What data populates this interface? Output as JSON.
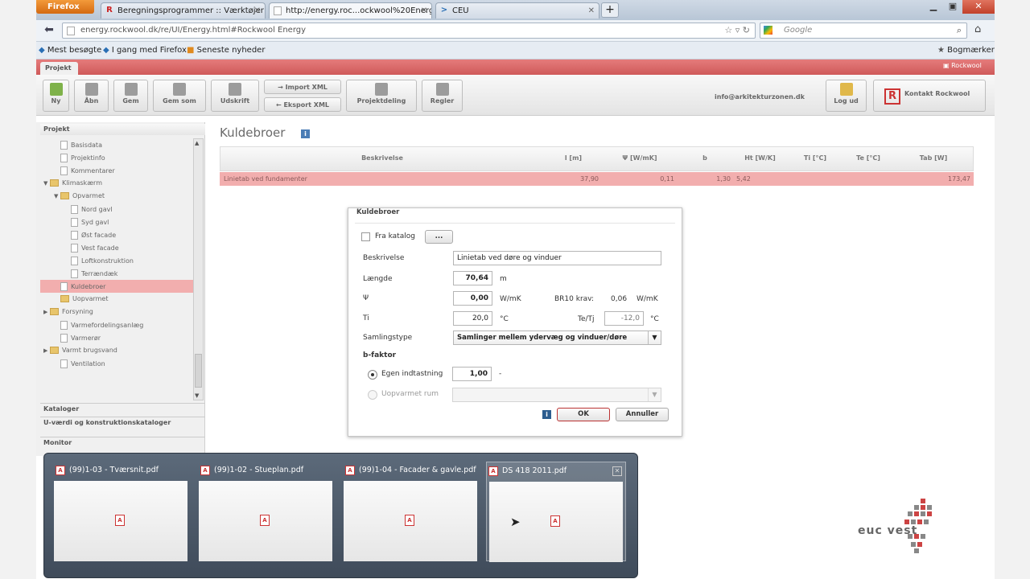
{
  "browser": {
    "firefox_button": "Firefox",
    "tabs": [
      {
        "label": "Beregningsprogrammer :: Værktøjer :...",
        "favicon": "R"
      },
      {
        "label": "http://energy.roc...ockwool%20Energy",
        "favicon": ""
      },
      {
        "label": "CEU",
        "favicon": ">"
      }
    ],
    "new_tab": "+",
    "url": "energy.rockwool.dk/re/UI/Energy.html#Rockwool Energy",
    "search_placeholder": "Google",
    "bookmarks": [
      "Mest besøgte",
      "I gang med Firefox",
      "Seneste nyheder"
    ],
    "bookmarks_menu": "Bogmærker"
  },
  "app": {
    "top_tab": "Projekt",
    "brand_top": "Rockwool",
    "toolbar": {
      "buttons": [
        "Ny",
        "Åbn",
        "Gem",
        "Gem som",
        "Udskrift"
      ],
      "import_xml": "Import XML",
      "export_xml": "Eksport XML",
      "project_share": "Projektdeling",
      "rules": "Regler",
      "email": "info@arkitekturzonen.dk",
      "logout": "Log ud",
      "contact": "Kontakt Rockwool"
    },
    "sidebar": {
      "header": "Projekt",
      "items": [
        {
          "label": "Basisdata",
          "type": "page",
          "indent": 1
        },
        {
          "label": "Projektinfo",
          "type": "page",
          "indent": 1
        },
        {
          "label": "Kommentarer",
          "type": "page",
          "indent": 1
        },
        {
          "label": "Klimaskærm",
          "type": "folder",
          "indent": 0
        },
        {
          "label": "Opvarmet",
          "type": "folder",
          "indent": 1
        },
        {
          "label": "Nord gavl",
          "type": "page",
          "indent": 2
        },
        {
          "label": "Syd gavl",
          "type": "page",
          "indent": 2
        },
        {
          "label": "Øst facade",
          "type": "page",
          "indent": 2
        },
        {
          "label": "Vest facade",
          "type": "page",
          "indent": 2
        },
        {
          "label": "Loftkonstruktion",
          "type": "page",
          "indent": 2
        },
        {
          "label": "Terrændæk",
          "type": "page",
          "indent": 2
        },
        {
          "label": "Kuldebroer",
          "type": "page",
          "indent": 1,
          "selected": true
        },
        {
          "label": "Uopvarmet",
          "type": "folder",
          "indent": 1
        },
        {
          "label": "Forsyning",
          "type": "folder",
          "indent": 0
        },
        {
          "label": "Varmefordelingsanlæg",
          "type": "page",
          "indent": 1
        },
        {
          "label": "Varmerør",
          "type": "page",
          "indent": 1
        },
        {
          "label": "Varmt brugsvand",
          "type": "folder",
          "indent": 0
        },
        {
          "label": "Ventilation",
          "type": "page",
          "indent": 1
        }
      ],
      "sections": [
        "Kataloger",
        "U-værdi og konstruktionskataloger",
        "Monitor"
      ]
    },
    "main": {
      "title": "Kuldebroer",
      "columns": [
        "Beskrivelse",
        "l [m]",
        "Ψ [W/mK]",
        "b",
        "Ht [W/K]",
        "Ti [°C]",
        "Te [°C]",
        "Tab [W]"
      ],
      "row": [
        "Linietab ved fundamenter",
        "37,90",
        "0,11",
        "1,30",
        "5,42",
        "",
        "",
        "173,47"
      ]
    }
  },
  "dialog": {
    "title": "Kuldebroer",
    "fra_katalog": "Fra katalog",
    "katalog_btn": "...",
    "beskrivelse_label": "Beskrivelse",
    "beskrivelse_value": "Linietab ved døre og vinduer",
    "laengde_label": "Længde",
    "laengde_value": "70,64",
    "laengde_unit": "m",
    "psi_label": "Ψ",
    "psi_value": "0,00",
    "psi_unit": "W/mK",
    "br10_label": "BR10 krav:",
    "br10_value": "0,06",
    "br10_unit": "W/mK",
    "ti_label": "Ti",
    "ti_value": "20,0",
    "ti_unit": "°C",
    "tetj_label": "Te/Tj",
    "tetj_value": "-12,0",
    "tetj_unit": "°C",
    "samling_label": "Samlingstype",
    "samling_value": "Samlinger mellem ydervæg og vinduer/døre",
    "bfaktor_label": "b-faktor",
    "egen_label": "Egen indtastning",
    "egen_value": "1,00",
    "egen_unit": "-",
    "uopvarmet_label": "Uopvarmet rum",
    "ok": "OK",
    "cancel": "Annuller"
  },
  "taskbar": {
    "previews": [
      "(99)1-03 - Tværsnit.pdf",
      "(99)1-02 - Stueplan.pdf",
      "(99)1-04 - Facader & gavle.pdf",
      "DS 418 2011.pdf"
    ]
  },
  "logo": "euc  vest"
}
